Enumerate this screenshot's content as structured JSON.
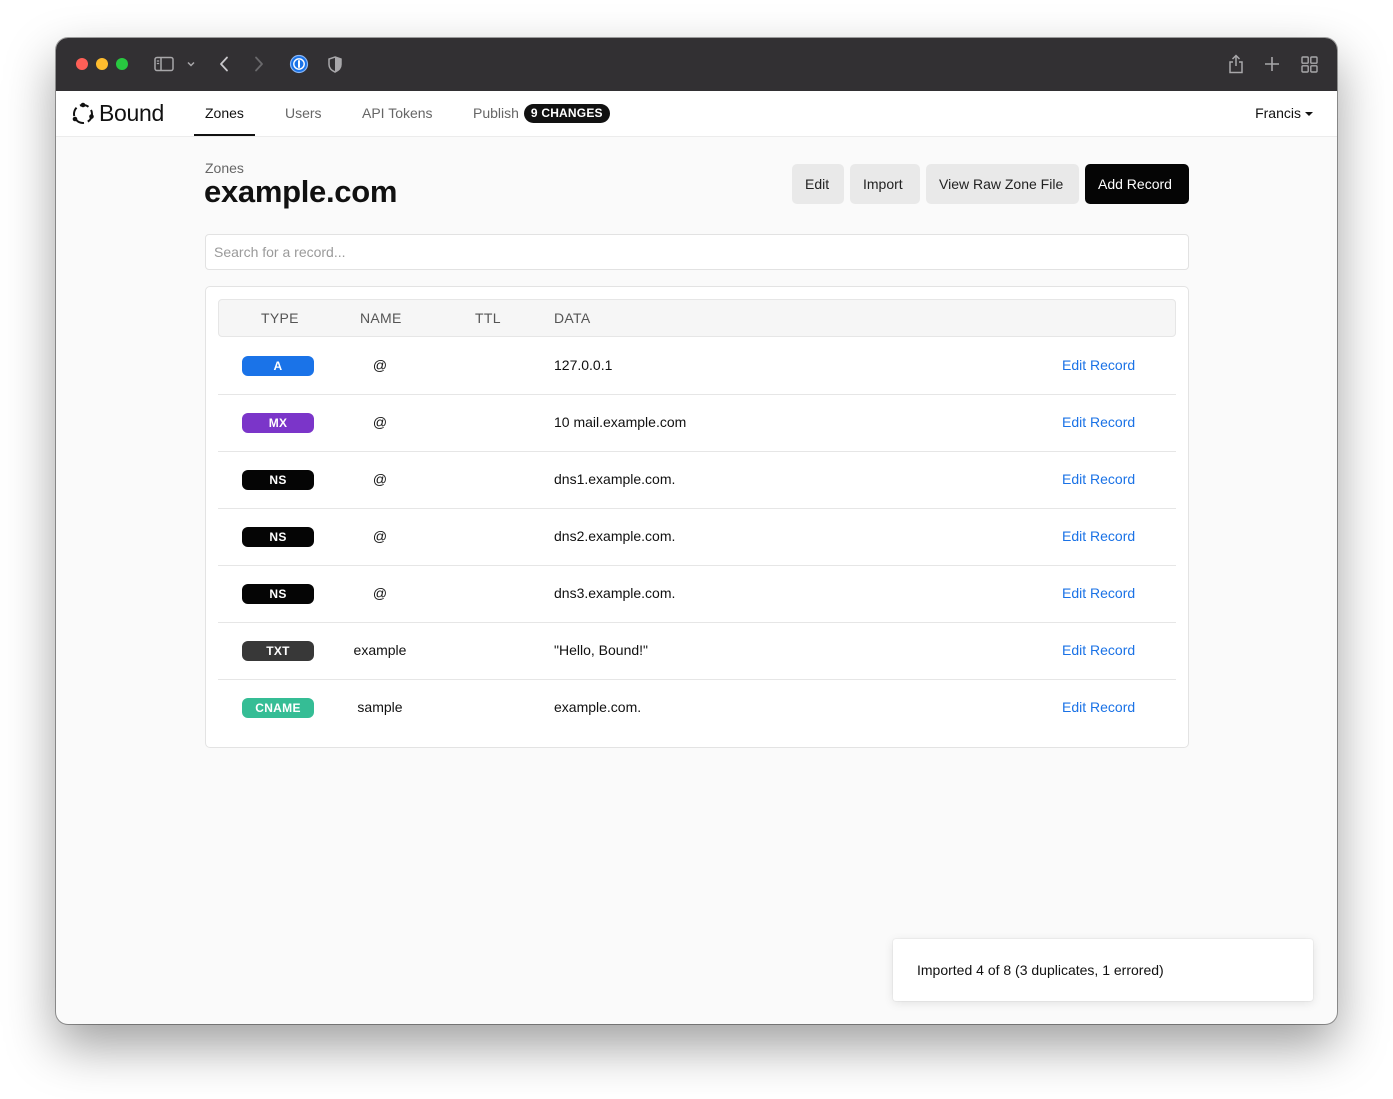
{
  "app": {
    "name": "Bound"
  },
  "nav": {
    "tabs": [
      {
        "label": "Zones",
        "active": true
      },
      {
        "label": "Users",
        "active": false
      },
      {
        "label": "API Tokens",
        "active": false
      },
      {
        "label": "Publish",
        "active": false
      }
    ],
    "publish_badge": "9 CHANGES",
    "user": "Francis"
  },
  "page": {
    "breadcrumb": "Zones",
    "title": "example.com",
    "buttons": {
      "edit": "Edit",
      "import": "Import",
      "view_raw": "View Raw Zone File",
      "add_record": "Add Record"
    },
    "search_placeholder": "Search for a record..."
  },
  "table": {
    "headers": [
      "TYPE",
      "NAME",
      "TTL",
      "DATA"
    ],
    "edit_label": "Edit Record",
    "rows": [
      {
        "type": "A",
        "type_color": "#1a73e8",
        "name": "@",
        "ttl": "",
        "data": "127.0.0.1"
      },
      {
        "type": "MX",
        "type_color": "#7b35c9",
        "name": "@",
        "ttl": "",
        "data": "10 mail.example.com"
      },
      {
        "type": "NS",
        "type_color": "#050505",
        "name": "@",
        "ttl": "",
        "data": "dns1.example.com."
      },
      {
        "type": "NS",
        "type_color": "#050505",
        "name": "@",
        "ttl": "",
        "data": "dns2.example.com."
      },
      {
        "type": "NS",
        "type_color": "#050505",
        "name": "@",
        "ttl": "",
        "data": "dns3.example.com."
      },
      {
        "type": "TXT",
        "type_color": "#383838",
        "name": "example",
        "ttl": "",
        "data": "\"Hello, Bound!\""
      },
      {
        "type": "CNAME",
        "type_color": "#35bd95",
        "name": "sample",
        "ttl": "",
        "data": "example.com."
      }
    ]
  },
  "toast": {
    "message": "Imported 4 of 8 (3 duplicates, 1 errored)"
  },
  "icons": {
    "browser": [
      "sidebar-icon",
      "chevron-down-icon",
      "back-arrow-icon",
      "forward-arrow-icon",
      "password-manager-icon",
      "shield-icon",
      "share-icon",
      "new-tab-icon",
      "tab-overview-icon"
    ],
    "logo": "bound-logo-icon"
  }
}
